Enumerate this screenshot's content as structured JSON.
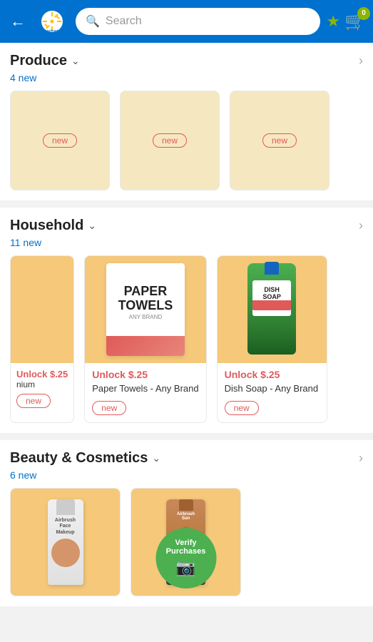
{
  "header": {
    "back_label": "←",
    "search_placeholder": "Search",
    "cart_count": "0",
    "star_label": "★"
  },
  "produce_section": {
    "title": "Produce",
    "new_count": "4 new",
    "arrow": "›",
    "cards": [
      {
        "badge": "new"
      },
      {
        "badge": "new"
      },
      {
        "badge": "new"
      }
    ]
  },
  "household_section": {
    "title": "Household",
    "new_count": "11 new",
    "arrow": "›",
    "cards": [
      {
        "unlock_price": "Unlock $.25",
        "name": "nium",
        "badge": "new",
        "partial": true
      },
      {
        "unlock_price": "Unlock $.25",
        "name": "Paper Towels - Any Brand",
        "badge": "new",
        "type": "paper_towels"
      },
      {
        "unlock_price": "Unlock $.25",
        "name": "Dish Soap - Any Brand",
        "badge": "new",
        "type": "dish_soap"
      }
    ]
  },
  "beauty_section": {
    "title": "Beauty & Cosmetics",
    "new_count": "6 new",
    "arrow": "›",
    "cards": [
      {
        "type": "airbrush_makeup",
        "label": "Airbrush\nFace\nMakeup"
      },
      {
        "type": "airbrush_sun",
        "label": "Airbrush\nSun",
        "verify_label": "Verify\nPurchases"
      }
    ]
  },
  "colors": {
    "header_bg": "#0071CE",
    "accent_green": "#8DB500",
    "red": "#e05a5a",
    "gold": "#f5c87a"
  }
}
